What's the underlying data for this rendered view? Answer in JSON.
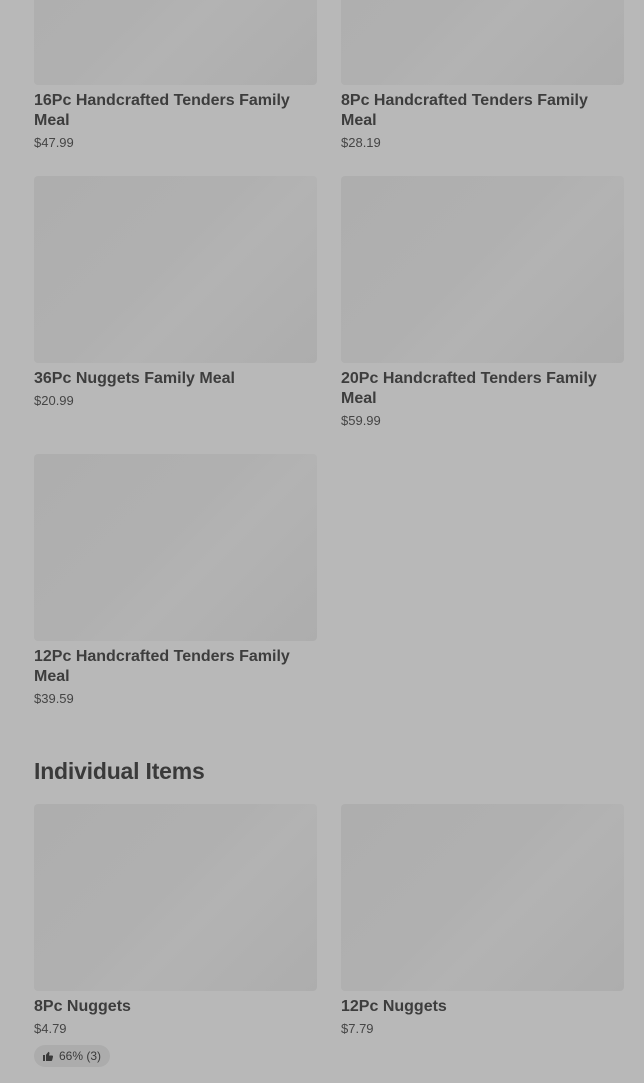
{
  "family_meals": [
    {
      "name": "16Pc Handcrafted Tenders Family Meal",
      "price": "$47.99"
    },
    {
      "name": "8Pc Handcrafted Tenders Family Meal",
      "price": "$28.19"
    },
    {
      "name": "36Pc Nuggets Family Meal",
      "price": "$20.99"
    },
    {
      "name": "20Pc Handcrafted Tenders Family Meal",
      "price": "$59.99"
    },
    {
      "name": "12Pc Handcrafted Tenders Family Meal",
      "price": "$39.59"
    }
  ],
  "individual_section": {
    "title": "Individual Items"
  },
  "individual_items": [
    {
      "name": "8Pc Nuggets",
      "price": "$4.79",
      "rating": "66% (3)",
      "rating_icon": "thumbs-up-icon"
    },
    {
      "name": "12Pc Nuggets",
      "price": "$7.79"
    }
  ]
}
